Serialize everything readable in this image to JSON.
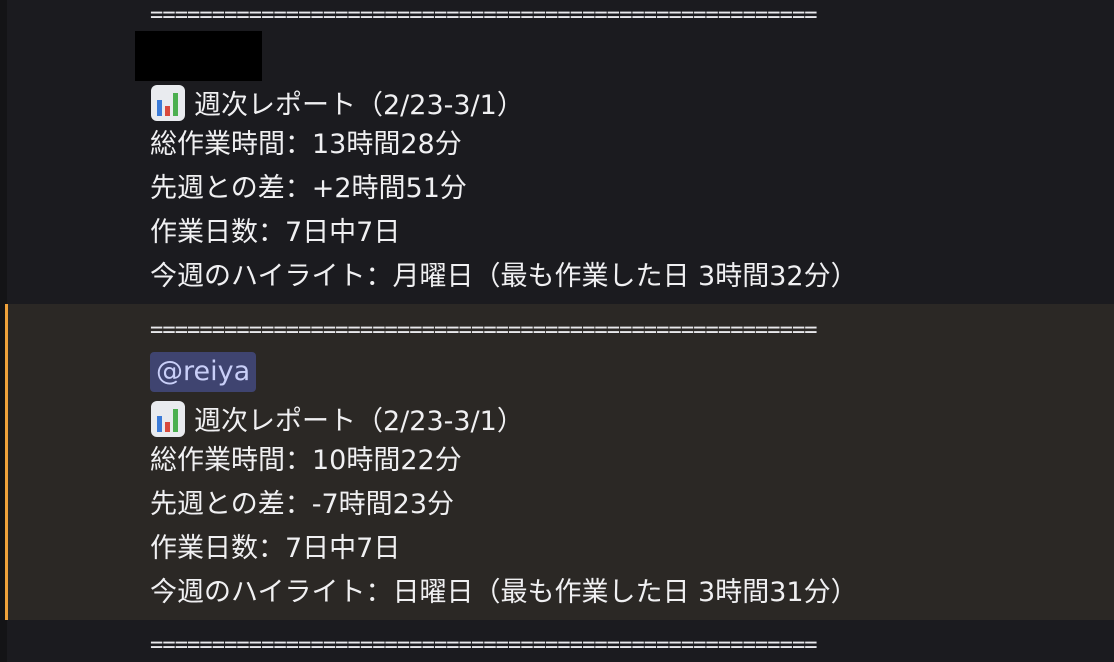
{
  "separator": "======================================================",
  "messages": [
    {
      "redacted": true,
      "emoji": "bar-chart-icon",
      "title": "週次レポート（2/23-3/1）",
      "total": "総作業時間：13時間28分",
      "diff": "先週との差：+2時間51分",
      "days": "作業日数：7日中7日",
      "highlight": "今週のハイライト：月曜日（最も作業した日 3時間32分）"
    },
    {
      "mention": "@reiya",
      "emoji": "bar-chart-icon",
      "title": "週次レポート（2/23-3/1）",
      "total": "総作業時間：10時間22分",
      "diff": "先週との差：-7時間23分",
      "days": "作業日数：7日中7日",
      "highlight": "今週のハイライト：日曜日（最も作業した日 3時間31分）"
    }
  ],
  "colors": {
    "background": "#1b1b1f",
    "highlight_background": "#2b2825",
    "highlight_bar": "#f0a23b",
    "mention_background": "#3f4470",
    "mention_text": "#c9cff8"
  }
}
